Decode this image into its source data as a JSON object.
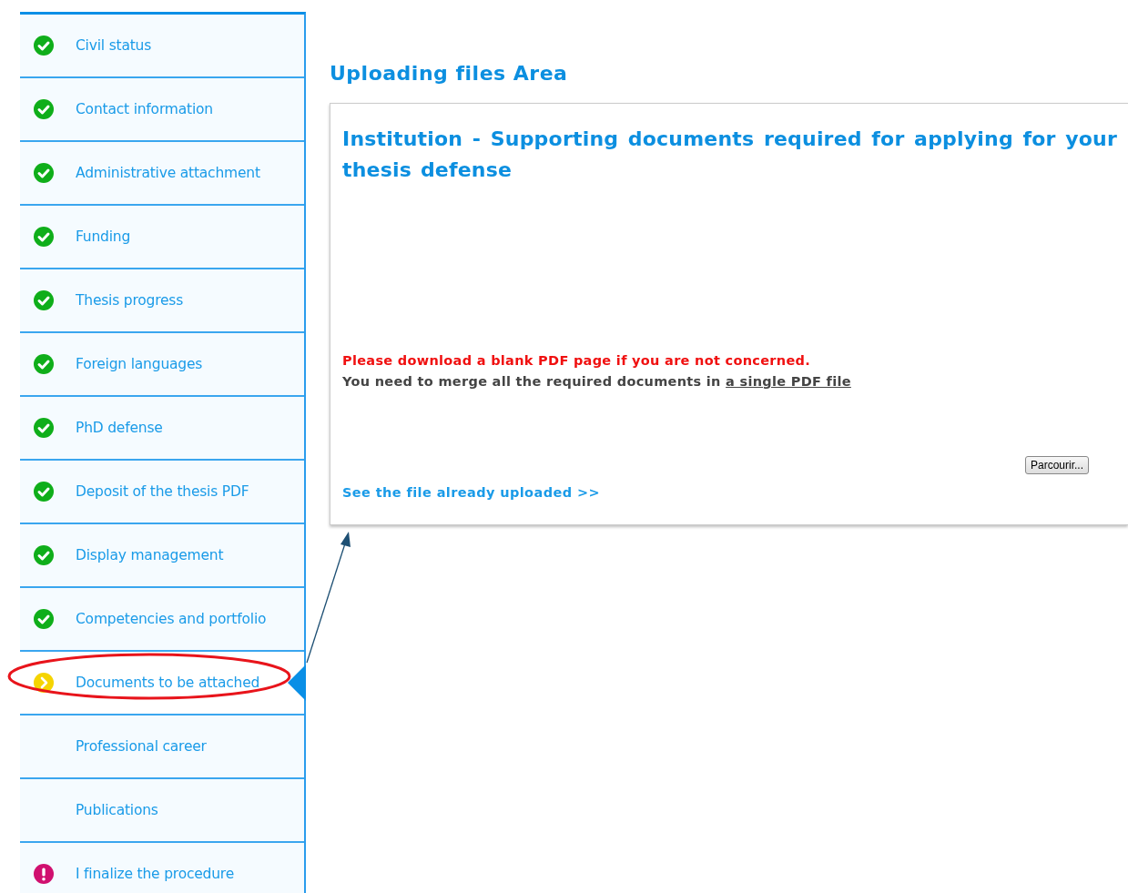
{
  "sidebar": {
    "items": [
      {
        "label": "Civil status",
        "kind": "done",
        "selected": false
      },
      {
        "label": "Contact information",
        "kind": "done",
        "selected": false
      },
      {
        "label": "Administrative attachment",
        "kind": "done",
        "selected": false
      },
      {
        "label": "Funding",
        "kind": "done",
        "selected": false
      },
      {
        "label": "Thesis progress",
        "kind": "done",
        "selected": false
      },
      {
        "label": "Foreign languages",
        "kind": "done",
        "selected": false
      },
      {
        "label": "PhD defense",
        "kind": "done",
        "selected": false
      },
      {
        "label": "Deposit of the thesis PDF",
        "kind": "done",
        "selected": false
      },
      {
        "label": "Display management",
        "kind": "done",
        "selected": false
      },
      {
        "label": "Competencies and portfolio",
        "kind": "done",
        "selected": false
      },
      {
        "label": "Documents to be attached",
        "kind": "current",
        "selected": true
      },
      {
        "label": "Professional career",
        "kind": "plain",
        "selected": false
      },
      {
        "label": "Publications",
        "kind": "plain",
        "selected": false
      },
      {
        "label": "I finalize the procedure",
        "kind": "alert",
        "selected": false
      }
    ]
  },
  "main": {
    "title": "Uploading files Area",
    "panel": {
      "heading": "Institution - Supporting documents required for applying for your thesis defense",
      "warning": "Please download a blank PDF page if you are not concerned.",
      "note": "You need to merge all the required documents in ",
      "note_link": "a single PDF file",
      "browse_button": "Parcourir...",
      "uploaded_link": "See the file already uploaded >>"
    }
  },
  "annotation": {
    "ellipse": true,
    "arrow": true
  }
}
